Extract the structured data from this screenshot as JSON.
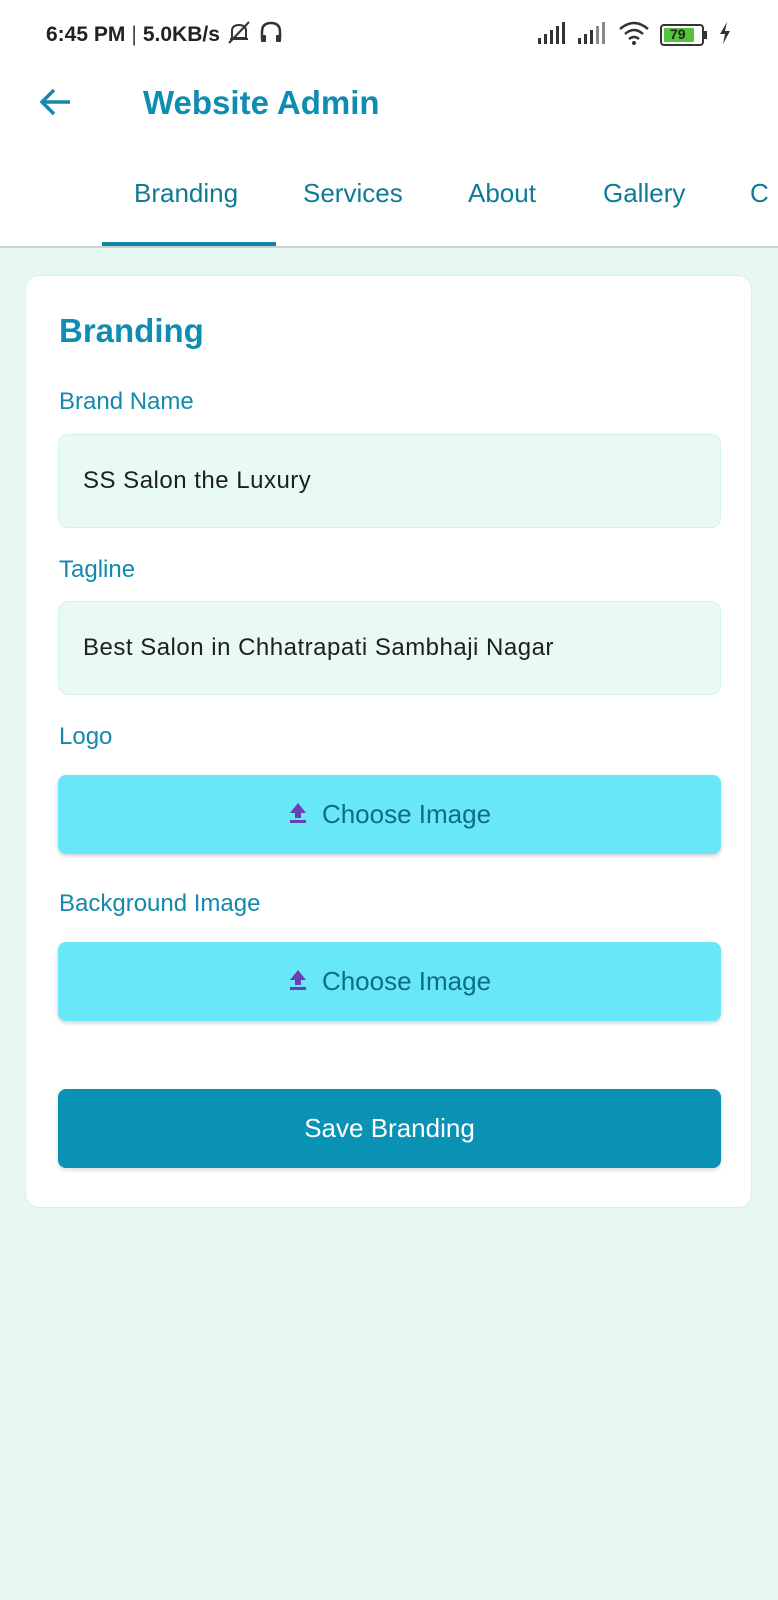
{
  "status_bar": {
    "time": "6:45 PM",
    "separator": "|",
    "speed": "5.0KB/s",
    "battery": "79",
    "icons": [
      "muted-bell-icon",
      "headphones-icon",
      "signal-icon",
      "signal-icon",
      "wifi-icon",
      "battery-icon",
      "charging-icon"
    ]
  },
  "appbar": {
    "title": "Website Admin",
    "back_icon": "arrow-left-icon"
  },
  "tabs": [
    {
      "label": "Branding",
      "active": true
    },
    {
      "label": "Services",
      "active": false
    },
    {
      "label": "About",
      "active": false
    },
    {
      "label": "Gallery",
      "active": false
    },
    {
      "label": "C",
      "active": false
    }
  ],
  "card": {
    "title": "Branding",
    "brand_name": {
      "label": "Brand Name",
      "value": "SS Salon the Luxury"
    },
    "tagline": {
      "label": "Tagline",
      "value": "Best Salon in Chhatrapati Sambhaji Nagar"
    },
    "logo": {
      "label": "Logo",
      "button": "Choose Image",
      "icon": "upload-icon"
    },
    "background_image": {
      "label": "Background Image",
      "button": "Choose Image",
      "icon": "upload-icon"
    },
    "save_button": "Save Branding"
  },
  "colors": {
    "primary": "#0e8db3",
    "page_bg": "#e6f8f1",
    "upload_button": "#67e7f7",
    "save_button": "#0a92b5",
    "upload_icon": "#6a3fb5"
  }
}
